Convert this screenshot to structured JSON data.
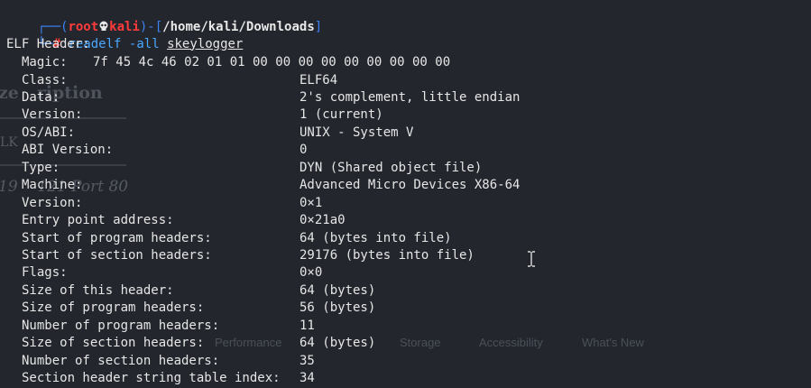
{
  "prompt": {
    "open1": "┌──(",
    "user": "root",
    "host": "kali",
    "close1": ")-[",
    "path": "/home/kali/Downloads",
    "close2": "]",
    "open2": "└─",
    "hash": "#",
    "command": "readelf",
    "flag": "-all",
    "file": "skeylogger"
  },
  "header_title": "ELF Header:",
  "magic": {
    "label": "Magic:",
    "value": "7f 45 4c 46 02 01 01 00 00 00 00 00 00 00 00 00"
  },
  "fields": [
    {
      "label": "Class:",
      "value": "ELF64"
    },
    {
      "label": "Data:",
      "value": "2's complement, little endian"
    },
    {
      "label": "Version:",
      "value": "1 (current)"
    },
    {
      "label": "OS/ABI:",
      "value": "UNIX - System V"
    },
    {
      "label": "ABI Version:",
      "value": "0"
    },
    {
      "label": "Type:",
      "value": "DYN (Shared object file)"
    },
    {
      "label": "Machine:",
      "value": "Advanced Micro Devices X86-64"
    },
    {
      "label": "Version:",
      "value": "0×1"
    },
    {
      "label": "Entry point address:",
      "value": "0×21a0"
    },
    {
      "label": "Start of program headers:",
      "value": "64 (bytes into file)"
    },
    {
      "label": "Start of section headers:",
      "value": "29176 (bytes into file)"
    },
    {
      "label": "Flags:",
      "value": "0×0"
    },
    {
      "label": "Size of this header:",
      "value": "64 (bytes)"
    },
    {
      "label": "Size of program headers:",
      "value": "56 (bytes)"
    },
    {
      "label": "Number of program headers:",
      "value": "11"
    },
    {
      "label": "Size of section headers:",
      "value": "64 (bytes)"
    },
    {
      "label": "Number of section headers:",
      "value": "35"
    },
    {
      "label": "Section header string table index:",
      "value": "34"
    }
  ],
  "background_ghost": {
    "description": "ze   ription",
    "small": "LK",
    "port": "19    121 Port 80",
    "devtools": [
      "Performance",
      "Storage",
      "Accessibility",
      "What's New"
    ]
  },
  "cursor_icon": "text-cursor-icon",
  "colors": {
    "background": "#23262d",
    "accent_red": "#ff3b3b",
    "accent_blue": "#3b82f6",
    "command_blue": "#4aa8ff"
  }
}
